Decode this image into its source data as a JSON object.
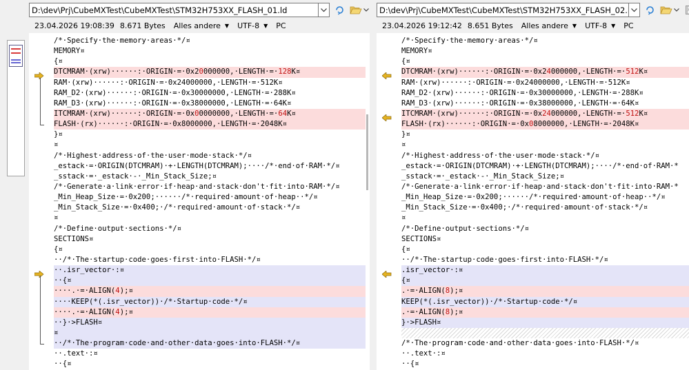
{
  "left": {
    "path": "D:\\dev\\Prj\\CubeMXTest\\CubeMXTest\\STM32H753XX_FLASH_01.ld",
    "timestamp": "23.04.2026 19:08:39",
    "size": "8.671 Bytes",
    "filter": "Alles andere",
    "encoding": "UTF-8",
    "line_ending": "PC",
    "lines": [
      {
        "t": "/*·Specify·the·memory·areas·*/¤"
      },
      {
        "t": "MEMORY¤"
      },
      {
        "t": "{¤"
      },
      {
        "k": "diff",
        "mark": "arrow",
        "t": "DTCMRAM·(xrw)······:·ORIGIN·=·0x2",
        "h": "0",
        "t2": "000000,·LENGTH·=·",
        "h2": "128",
        "t3": "K¤"
      },
      {
        "t": "RAM·(xrw)······:·ORIGIN·=·0x24000000,·LENGTH·=·512K¤"
      },
      {
        "t": "RAM_D2·(xrw)······:·ORIGIN·=·0x30000000,·LENGTH·=·288K¤"
      },
      {
        "t": "RAM_D3·(xrw)······:·ORIGIN·=·0x38000000,·LENGTH·=·64K¤"
      },
      {
        "k": "diff",
        "t": "ITCMRAM·(xrw)······:·ORIGIN·=·0x",
        "h": "0",
        "t2": "0000000,·LENGTH·=·",
        "h2": "64",
        "t3": "K¤"
      },
      {
        "k": "diff",
        "mark": "bracket-end",
        "t": "FLASH·(rx)······:·ORIGIN·=·0x8000000,·LENGTH·=·2048K¤"
      },
      {
        "t": "}¤"
      },
      {
        "t": "¤"
      },
      {
        "t": "/*·Highest·address·of·the·user·mode·stack·*/¤"
      },
      {
        "t": "_estack·=·ORIGIN(DTCMRAM)·+·LENGTH(DTCMRAM);····/*·end·of·RAM·*/¤"
      },
      {
        "t": "_sstack·=·_estack·-·_Min_Stack_Size;¤"
      },
      {
        "t": "/*·Generate·a·link·error·if·heap·and·stack·don't·fit·into·RAM·*/¤"
      },
      {
        "t": "_Min_Heap_Size·=·0x200;······/*·required·amount·of·heap··*/¤"
      },
      {
        "t": "_Min_Stack_Size·=·0x400;·/*·required·amount·of·stack·*/¤"
      },
      {
        "t": "¤"
      },
      {
        "t": "/*·Define·output·sections·*/¤"
      },
      {
        "t": "SECTIONS¤"
      },
      {
        "t": "{¤"
      },
      {
        "t": "··/*·The·startup·code·goes·first·into·FLASH·*/¤"
      },
      {
        "k": "move",
        "mark": "arrow",
        "t": "··.isr_vector·:¤"
      },
      {
        "k": "move",
        "t": "··{¤"
      },
      {
        "k": "diff",
        "t": "····.·=·ALIGN(",
        "h": "4",
        "t2": ");¤"
      },
      {
        "k": "move",
        "t": "····KEEP(*(.isr_vector))·/*·Startup·code·*/¤"
      },
      {
        "k": "diff",
        "t": "····.·=·ALIGN(",
        "h": "4",
        "t2": ");¤"
      },
      {
        "k": "move",
        "t": "··}·>FLASH¤"
      },
      {
        "k": "move",
        "t": "¤"
      },
      {
        "k": "move",
        "mark": "bracket-end",
        "t": "··/*·The·program·code·and·other·data·goes·into·FLASH·*/¤"
      },
      {
        "t": "··.text·:¤"
      },
      {
        "t": "··{¤"
      }
    ]
  },
  "right": {
    "path": "D:\\dev\\Prj\\CubeMXTest\\CubeMXTest\\STM32H753XX_FLASH_02.ld",
    "timestamp": "23.04.2026 19:12:42",
    "size": "8.651 Bytes",
    "filter": "Alles andere",
    "encoding": "UTF-8",
    "line_ending": "PC",
    "lines": [
      {
        "t": "/*·Specify·the·memory·areas·*/¤"
      },
      {
        "t": "MEMORY¤"
      },
      {
        "t": "{¤"
      },
      {
        "k": "diff",
        "mark": "arrow",
        "t": "DTCMRAM·(xrw)······:·ORIGIN·=·0x2",
        "h": "4",
        "t2": "000000,·LENGTH·=·",
        "h2": "512",
        "t3": "K¤"
      },
      {
        "t": "RAM·(xrw)······:·ORIGIN·=·0x24000000,·LENGTH·=·512K¤"
      },
      {
        "t": "RAM_D2·(xrw)······:·ORIGIN·=·0x30000000,·LENGTH·=·288K¤"
      },
      {
        "t": "RAM_D3·(xrw)······:·ORIGIN·=·0x38000000,·LENGTH·=·64K¤"
      },
      {
        "k": "diff",
        "mark": "arrow",
        "t": "ITCMRAM·(xrw)······:·ORIGIN·=·0x",
        "h": "24",
        "t2": "000000,·LENGTH·=·",
        "h2": "512",
        "t3": "K¤"
      },
      {
        "k": "diff",
        "t": "FLASH·(rx)······:·ORIGIN·=·0x",
        "h": "0",
        "t2": "8000000,·LENGTH·=·2048K¤"
      },
      {
        "t": "}¤"
      },
      {
        "t": "¤"
      },
      {
        "t": "/*·Highest·address·of·the·user·mode·stack·*/¤"
      },
      {
        "t": "_estack·=·ORIGIN(DTCMRAM)·+·LENGTH(DTCMRAM);····/*·end·of·RAM·*"
      },
      {
        "t": "_sstack·=·_estack·-·_Min_Stack_Size;¤"
      },
      {
        "t": "/*·Generate·a·link·error·if·heap·and·stack·don't·fit·into·RAM·*"
      },
      {
        "t": "_Min_Heap_Size·=·0x200;······/*·required·amount·of·heap··*/¤"
      },
      {
        "t": "_Min_Stack_Size·=·0x400;·/*·required·amount·of·stack·*/¤"
      },
      {
        "t": "¤"
      },
      {
        "t": "/*·Define·output·sections·*/¤"
      },
      {
        "t": "SECTIONS¤"
      },
      {
        "t": "{¤"
      },
      {
        "t": "··/*·The·startup·code·goes·first·into·FLASH·*/¤"
      },
      {
        "k": "move",
        "mark": "arrow",
        "t": ".isr_vector·:¤"
      },
      {
        "k": "move",
        "t": "{¤"
      },
      {
        "k": "diff",
        "t": ".·=·ALIGN(",
        "h": "8",
        "t2": ");¤"
      },
      {
        "k": "move",
        "t": "KEEP(*(.isr_vector))·/*·Startup·code·*/¤"
      },
      {
        "k": "diff",
        "t": ".·=·ALIGN(",
        "h": "8",
        "t2": ");¤"
      },
      {
        "k": "move",
        "t": "}·>FLASH¤"
      },
      {
        "k": "gap",
        "t": ""
      },
      {
        "t": "/*·The·program·code·and·other·data·goes·into·FLASH·*/¤"
      },
      {
        "t": "··.text·:¤"
      },
      {
        "t": "··{¤"
      }
    ]
  },
  "colors": {
    "diff_bg": "#fcdcdc",
    "move_bg": "#e4e4f8",
    "highlight": "#c01010",
    "arrow": "#e6b422"
  },
  "icons": {
    "dropdown": "chevron-down-icon",
    "open": "folder-open-icon",
    "save": "save-icon",
    "arrow": "diff-arrow-icon"
  }
}
